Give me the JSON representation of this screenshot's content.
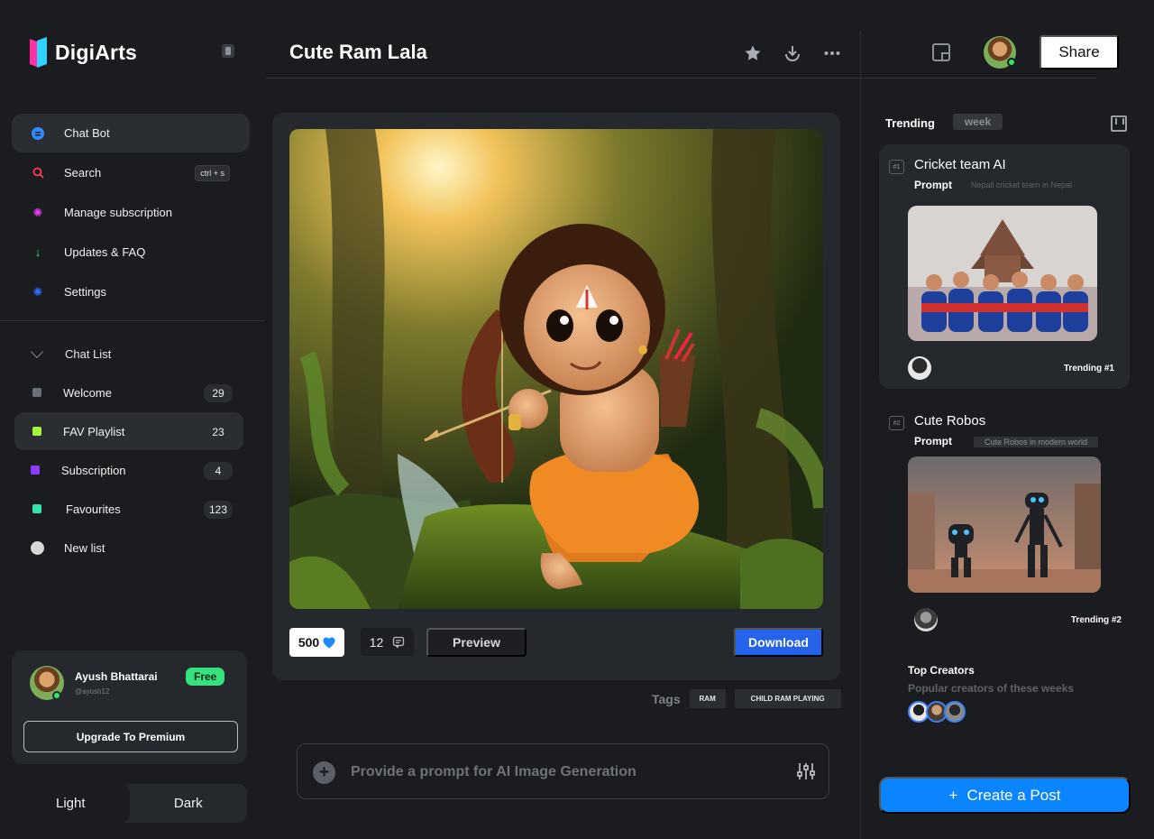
{
  "app": {
    "name": "DigiArts"
  },
  "sidebar": {
    "menu": [
      {
        "label": "Chat Bot",
        "icon": "chat-bot-icon",
        "color": "#2f8cff"
      },
      {
        "label": "Search",
        "icon": "search-icon",
        "color": "#ff3b5c",
        "shortcut": "ctrl + s"
      },
      {
        "label": "Manage subscription",
        "icon": "gear-icon",
        "color": "#e83cf0"
      },
      {
        "label": "Updates & FAQ",
        "icon": "arrow-down-icon",
        "color": "#35e27e"
      },
      {
        "label": "Settings",
        "icon": "gear-icon",
        "color": "#2f6dff"
      }
    ],
    "chat_list": {
      "title": "Chat List",
      "items": [
        {
          "label": "Welcome",
          "count": "29",
          "color": "#6b6f76"
        },
        {
          "label": "FAV Playlist",
          "count": "23",
          "color": "#a6f53c"
        },
        {
          "label": "Subscription",
          "count": "4",
          "color": "#8b3cff"
        },
        {
          "label": "Favourites",
          "count": "123",
          "color": "#35e2b0"
        },
        {
          "label": "New list",
          "count": "",
          "color": "#d8d8d8"
        }
      ]
    },
    "profile": {
      "name": "Ayush Bhattarai",
      "handle": "@ayush12",
      "plan": "Free",
      "upgrade_label": "Upgrade To Premium"
    },
    "theme": {
      "light_label": "Light",
      "dark_label": "Dark",
      "selected": "Light"
    }
  },
  "main": {
    "title": "Cute Ram Lala",
    "likes": "500",
    "comments": "12",
    "preview_label": "Preview",
    "download_label": "Download",
    "tags_label": "Tags",
    "tags": [
      "RAM",
      "CHILD RAM PLAYING"
    ],
    "prompt_placeholder": "Provide a prompt for AI Image Generation"
  },
  "right": {
    "share_label": "Share",
    "trending_label": "Trending",
    "period": "week",
    "cards": [
      {
        "rank": "#1",
        "title": "Cricket team AI",
        "prompt_label": "Prompt",
        "prompt": "Nepali cricket team in Nepal",
        "badge": "Trending #1"
      },
      {
        "rank": "#2",
        "title": "Cute Robos",
        "prompt_label": "Prompt",
        "prompt": "Cute Robos in modern world",
        "badge": "Trending #2"
      }
    ],
    "top_creators_title": "Top Creators",
    "top_creators_sub": "Popular creators of these weeks",
    "create_post_icon": "+",
    "create_post_label": "Create a Post"
  }
}
